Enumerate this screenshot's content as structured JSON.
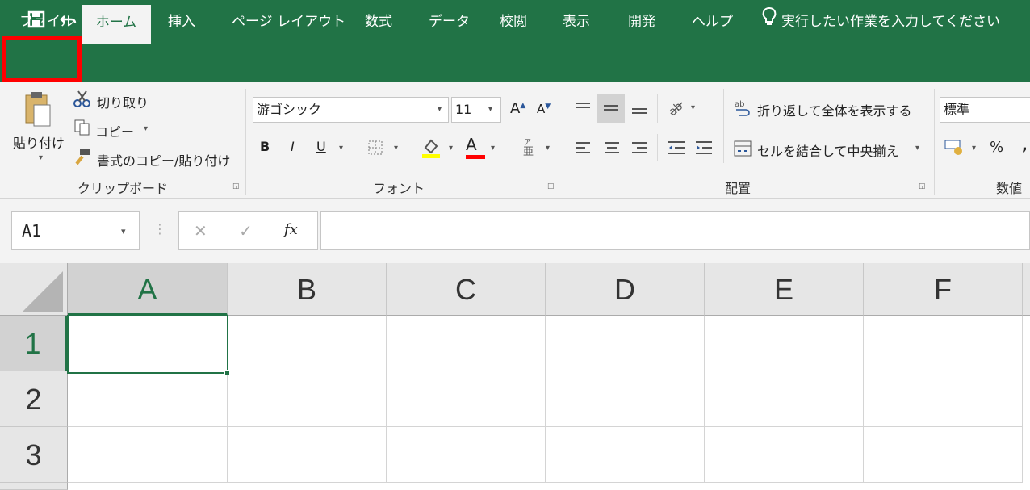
{
  "qat": {
    "save_icon": "save-icon",
    "undo_icon": "undo-icon",
    "redo_icon": "redo-icon",
    "customize": "▾"
  },
  "tabs": [
    "ファイル",
    "ホーム",
    "挿入",
    "ページ レイアウト",
    "数式",
    "データ",
    "校閲",
    "表示",
    "開発",
    "ヘルプ"
  ],
  "tell_me": "実行したい作業を入力してください",
  "clipboard": {
    "paste": "貼り付け",
    "cut": "切り取り",
    "copy": "コピー",
    "format_painter": "書式のコピー/貼り付け",
    "label": "クリップボード"
  },
  "font": {
    "name": "游ゴシック",
    "size": "11",
    "bold": "B",
    "italic": "I",
    "underline": "U",
    "grow": "A",
    "shrink": "A",
    "color_letter": "A",
    "label": "フォント"
  },
  "alignment": {
    "wrap": "折り返して全体を表示する",
    "merge": "セルを結合して中央揃え",
    "label": "配置"
  },
  "number": {
    "format": "標準",
    "percent": "%",
    "comma": ",",
    "label": "数値"
  },
  "formula_bar": {
    "name_box": "A1",
    "fx": "fx",
    "cancel": "✕",
    "enter": "✓",
    "value": ""
  },
  "sheet": {
    "columns": [
      "A",
      "B",
      "C",
      "D",
      "E",
      "F"
    ],
    "rows": [
      "1",
      "2",
      "3"
    ]
  },
  "colors": {
    "accent": "#217346",
    "highlight_border": "#ff0000",
    "highlighter": "#ffff00",
    "font_color": "#ff0000"
  }
}
